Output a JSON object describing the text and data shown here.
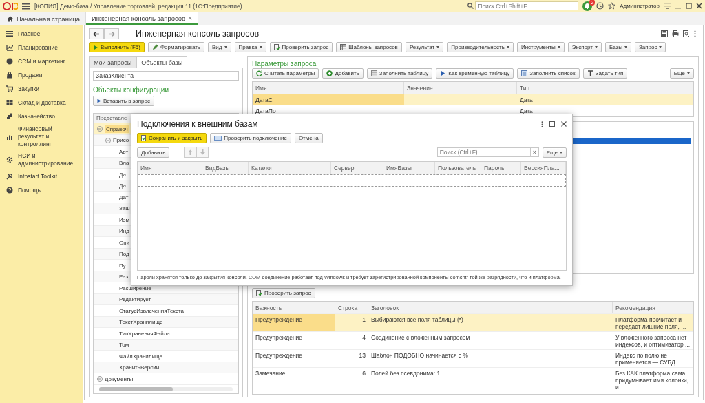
{
  "window": {
    "title": "[КОПИЯ] Демо-база / Управление торговлей, редакция 11  (1С:Предприятие)",
    "search_placeholder": "Поиск Ctrl+Shift+F",
    "notification_count": "2",
    "user": "Администратор"
  },
  "tabs": [
    {
      "label": "Начальная страница",
      "selected": false
    },
    {
      "label": "Инженерная консоль запросов",
      "selected": true,
      "close": "×"
    }
  ],
  "sidebar": {
    "items": [
      {
        "label": "Главное"
      },
      {
        "label": "Планирование"
      },
      {
        "label": "CRM и маркетинг"
      },
      {
        "label": "Продажи"
      },
      {
        "label": "Закупки"
      },
      {
        "label": "Склад и доставка"
      },
      {
        "label": "Казначейство"
      },
      {
        "label": "Финансовый результат и контроллинг"
      },
      {
        "label": "НСИ и администрирование"
      },
      {
        "label": "Infostart Toolkit"
      },
      {
        "label": "Помощь"
      }
    ]
  },
  "form": {
    "title": "Инженерная консоль запросов",
    "toolbar": [
      {
        "label": "Выполнить (F5)",
        "kind": "primary"
      },
      {
        "label": "Форматировать",
        "kind": "action"
      },
      {
        "label": "Вид",
        "kind": "menu"
      },
      {
        "label": "Правка",
        "kind": "menu"
      },
      {
        "label": "Проверить запрос",
        "kind": "action"
      },
      {
        "label": "Шаблоны запросов",
        "kind": "action"
      },
      {
        "label": "Результат",
        "kind": "menu"
      },
      {
        "label": "Производительность",
        "kind": "menu"
      },
      {
        "label": "Инструменты",
        "kind": "menu"
      },
      {
        "label": "Экспорт",
        "kind": "menu"
      },
      {
        "label": "Базы",
        "kind": "menu"
      },
      {
        "label": "Запрос",
        "kind": "menu"
      }
    ]
  },
  "left_panel": {
    "tabs": [
      {
        "label": "Мои запросы",
        "selected": false
      },
      {
        "label": "Объекты базы",
        "selected": true
      }
    ],
    "search_value": "ЗаказКлиента",
    "heading": "Объекты конфигурации",
    "insert_button": "Вставить в запрос",
    "tree_column": "Представле",
    "tree": [
      {
        "label": "Справоч",
        "selected": true,
        "expanded": true,
        "children": [
          {
            "label": "Присо",
            "selected": false,
            "expanded": true,
            "children": [
              {
                "label": "Авт",
                "selected": false
              },
              {
                "label": "Вла",
                "selected": false
              },
              {
                "label": "Дат",
                "selected": false
              },
              {
                "label": "Дат",
                "selected": false
              },
              {
                "label": "Дат",
                "selected": false
              },
              {
                "label": "Заш",
                "selected": false
              },
              {
                "label": "Изм",
                "selected": false
              },
              {
                "label": "Инд",
                "selected": false
              },
              {
                "label": "Опи",
                "selected": false
              },
              {
                "label": "Под",
                "selected": false
              },
              {
                "label": "Пут",
                "selected": false
              },
              {
                "label": "Раз",
                "selected": false
              },
              {
                "label": "Расширение",
                "selected": false
              },
              {
                "label": "Редактирует",
                "selected": false
              },
              {
                "label": "СтатусИзвлеченияТекста",
                "selected": false
              },
              {
                "label": "ТекстХранилище",
                "selected": false
              },
              {
                "label": "ТипХраненияФайла",
                "selected": false
              },
              {
                "label": "Том",
                "selected": false
              },
              {
                "label": "ФайлХранилище",
                "selected": false
              },
              {
                "label": "ХранитьВерсии",
                "selected": false
              }
            ]
          }
        ]
      },
      {
        "label": "Документы",
        "selected": false,
        "expanded": true
      }
    ]
  },
  "parameters": {
    "heading": "Параметры запроса",
    "buttons": [
      {
        "label": "Считать параметры"
      },
      {
        "label": "Добавить"
      },
      {
        "label": "Заполнить таблицу"
      },
      {
        "label": "Как временную таблицу"
      },
      {
        "label": "Заполнить список"
      },
      {
        "label": "Задать тип"
      }
    ],
    "more": "Еще",
    "columns": [
      "Имя",
      "Значение",
      "Тип"
    ],
    "rows": [
      {
        "name": "ДатаС",
        "type": "Дата",
        "selected": true
      },
      {
        "name": "ДатаПо",
        "type": "Дата",
        "selected": false
      }
    ]
  },
  "analysis": {
    "check_button": "Проверить запрос",
    "columns": [
      "Важность",
      "Строка",
      "Заголовок",
      "Рекомендация"
    ],
    "rows": [
      {
        "severity": "Предупреждение",
        "line": "1",
        "title": "Выбираются все поля таблицы (*)",
        "recommendation": "Платформа прочитает и передаст лишние поля, ...",
        "selected": true
      },
      {
        "severity": "Предупреждение",
        "line": "4",
        "title": "Соединение с вложенным запросом",
        "recommendation": "У вложенного запроса нет индексов, и оптимизатор ...",
        "selected": false
      },
      {
        "severity": "Предупреждение",
        "line": "13",
        "title": "Шаблон ПОДОБНО начинается с %",
        "recommendation": "Индекс по полю не применяется — СУБД ...",
        "selected": false
      },
      {
        "severity": "Замечание",
        "line": "6",
        "title": "Полей без псевдонима: 1",
        "recommendation": "Без КАК платформа сама придумывает имя колонки, и...",
        "selected": false
      }
    ]
  },
  "dialog": {
    "title": "Подключения к внешним базам",
    "buttons": [
      {
        "label": "Сохранить и закрыть",
        "kind": "primary"
      },
      {
        "label": "Проверить подключение",
        "kind": "action"
      },
      {
        "label": "Отмена",
        "kind": "plain"
      }
    ],
    "add_button": "Добавить",
    "search_placeholder": "Поиск (Ctrl+F)",
    "clear": "×",
    "more": "Еще",
    "columns": [
      "Имя",
      "ВидБазы",
      "Каталог",
      "Сервер",
      "ИмяБазы",
      "Пользователь",
      "Пароль",
      "ВерсияПла..."
    ],
    "note": "Пароли хранятся только до закрытия консоли. COM-соединение работает под Windows и требует зарегистрированной компоненты comcntr той же разрядности, что и платформа."
  }
}
